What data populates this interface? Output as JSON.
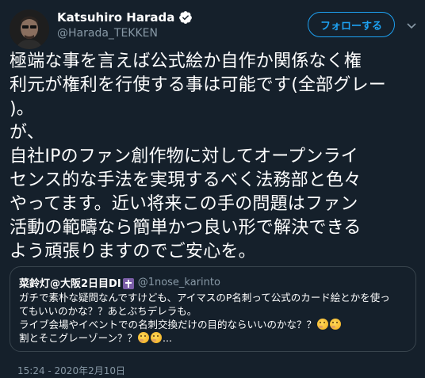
{
  "author": {
    "name": "Katsuhiro Harada",
    "handle": "@Harada_TEKKEN",
    "verified": true
  },
  "follow_button": {
    "label": "フォローする"
  },
  "tweet": {
    "text": "極端な事を言えば公式絵か自作か関係なく権\n利元が権利を行使する事は可能です(全部グレー\n)。\nが、\n自社IPのファン創作物に対してオープンライ\nセンス的な手法を実現するべく法務部と色々\nやってます。近い将来この手の問題はファン\n活動の範疇なら簡単かつ良い形で解決できる\nよう頑張りますのでご安心を。"
  },
  "quoted": {
    "name": "菜鈴灯@大阪2日目DI",
    "handle": "@1nose_karinto",
    "text_lines": [
      "ガチで素朴な疑問なんですけども、アイマスのP名刺って公式のカード絵とかを使っ",
      "てもいいのかな？？あとぶちデレラも。",
      "ライブ会場やイベントでの名刺交換だけの目的ならいいのかな？？",
      "割とそこグレーゾーン？？"
    ],
    "ellipsis": "..."
  },
  "timestamp": "15:24 - 2020年2月10日",
  "icons": {
    "verified": "verified-badge-icon",
    "chevron": "chevron-down-icon",
    "cross": "latin-cross-icon",
    "emoji": "thinking-face-icon"
  },
  "colors": {
    "background": "#15202b",
    "accent": "#1da1f2",
    "secondary_text": "#8899a6",
    "border": "#38444d"
  }
}
